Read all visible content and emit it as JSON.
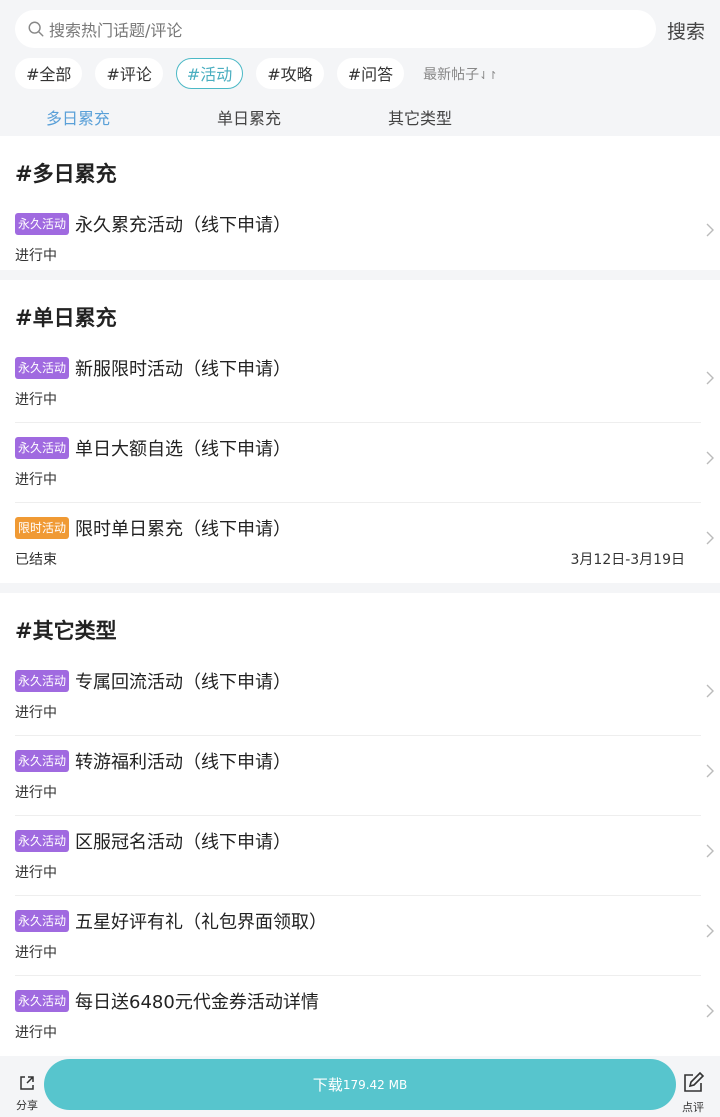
{
  "search": {
    "placeholder": "搜索热门话题/评论",
    "button": "搜索"
  },
  "chips": [
    "#全部",
    "#评论",
    "#活动",
    "#攻略",
    "#问答"
  ],
  "sort_label": "最新帖子",
  "tabs": [
    "多日累充",
    "单日累充",
    "其它类型"
  ],
  "sections": [
    {
      "title": "#多日累充",
      "items": [
        {
          "badge": "永久活动",
          "name": "永久累充活动（线下申请）",
          "status": "进行中",
          "date": ""
        }
      ]
    },
    {
      "title": "#单日累充",
      "items": [
        {
          "badge": "永久活动",
          "name": "新服限时活动（线下申请）",
          "status": "进行中",
          "date": ""
        },
        {
          "badge": "永久活动",
          "name": "单日大额自选（线下申请）",
          "status": "进行中",
          "date": ""
        },
        {
          "badge": "限时活动",
          "name": "限时单日累充（线下申请）",
          "status": "已结束",
          "date": "3月12日-3月19日"
        }
      ]
    },
    {
      "title": "#其它类型",
      "items": [
        {
          "badge": "永久活动",
          "name": "专属回流活动（线下申请）",
          "status": "进行中",
          "date": ""
        },
        {
          "badge": "永久活动",
          "name": "转游福利活动（线下申请）",
          "status": "进行中",
          "date": ""
        },
        {
          "badge": "永久活动",
          "name": "区服冠名活动（线下申请）",
          "status": "进行中",
          "date": ""
        },
        {
          "badge": "永久活动",
          "name": "五星好评有礼（礼包界面领取）",
          "status": "进行中",
          "date": ""
        },
        {
          "badge": "永久活动",
          "name": "每日送6480元代金券活动详情",
          "status": "进行中",
          "date": ""
        }
      ]
    }
  ],
  "bottom": {
    "share": "分享",
    "download": "下载",
    "size": "179.42 MB",
    "review": "点评"
  },
  "colors": {
    "accent": "#57c5cd",
    "badge_purple": "#a06ae0",
    "badge_orange": "#f09a34",
    "tab_active": "#5aa0d8"
  }
}
